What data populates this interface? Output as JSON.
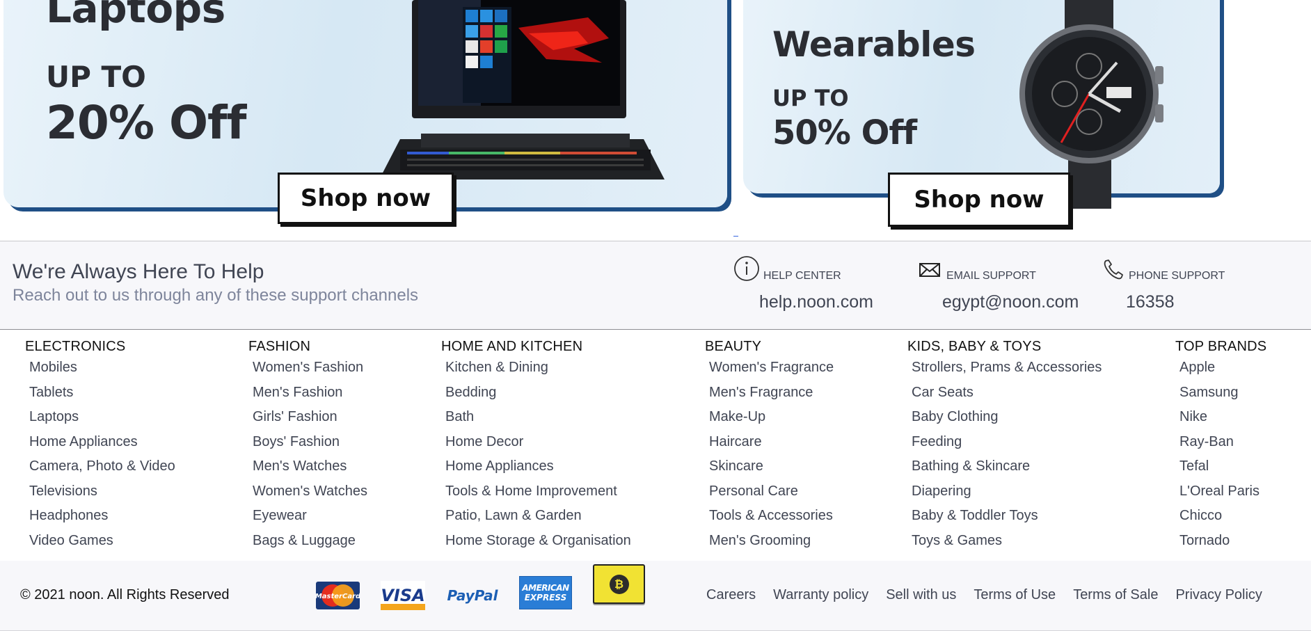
{
  "banners": {
    "laptops": {
      "headline": "Laptops",
      "upto": "UP TO",
      "offer": "20% Off",
      "cta": "Shop now"
    },
    "wearables": {
      "headline": "Wearables",
      "upto": "UP TO",
      "offer": "50% Off",
      "cta": "Shop now"
    }
  },
  "help": {
    "title": "We're Always Here To Help",
    "subtitle": "Reach out to us through any of these support channels",
    "channels": [
      {
        "label": "HELP CENTER",
        "value": "help.noon.com",
        "icon": "info-icon"
      },
      {
        "label": "EMAIL SUPPORT",
        "value": "egypt@noon.com",
        "icon": "envelope-icon"
      },
      {
        "label": "PHONE SUPPORT",
        "value": "16358",
        "icon": "phone-icon"
      }
    ]
  },
  "columns": [
    {
      "heading": "ELECTRONICS",
      "items": [
        "Mobiles",
        "Tablets",
        "Laptops",
        "Home Appliances",
        "Camera, Photo & Video",
        "Televisions",
        "Headphones",
        "Video Games"
      ]
    },
    {
      "heading": "FASHION",
      "items": [
        "Women's Fashion",
        "Men's Fashion",
        "Girls' Fashion",
        "Boys' Fashion",
        "Men's Watches",
        "Women's Watches",
        "Eyewear",
        "Bags & Luggage"
      ]
    },
    {
      "heading": "HOME AND KITCHEN",
      "items": [
        "Kitchen & Dining",
        "Bedding",
        "Bath",
        "Home Decor",
        "Home Appliances",
        "Tools & Home Improvement",
        "Patio, Lawn & Garden",
        "Home Storage & Organisation"
      ]
    },
    {
      "heading": "BEAUTY",
      "items": [
        "Women's Fragrance",
        "Men's Fragrance",
        "Make-Up",
        "Haircare",
        "Skincare",
        "Personal Care",
        "Tools & Accessories",
        "Men's Grooming"
      ]
    },
    {
      "heading": "KIDS, BABY & TOYS",
      "items": [
        "Strollers, Prams & Accessories",
        "Car Seats",
        "Baby Clothing",
        "Feeding",
        "Bathing & Skincare",
        "Diapering",
        "Baby & Toddler Toys",
        "Toys & Games"
      ]
    },
    {
      "heading": "TOP BRANDS",
      "items": [
        "Apple",
        "Samsung",
        "Nike",
        "Ray-Ban",
        "Tefal",
        "L'Oreal Paris",
        "Chicco",
        "Tornado"
      ]
    }
  ],
  "footer": {
    "copyright": "© 2021 noon. All Rights Reserved",
    "payments": {
      "mastercard": "MasterCard",
      "visa": "VISA",
      "paypal": "PayPal",
      "amex_line1": "AMERICAN",
      "amex_line2": "EXPRESS",
      "bitcoin": "₿"
    },
    "links": [
      "Careers",
      "Warranty policy",
      "Sell with us",
      "Terms of Use",
      "Terms of Sale",
      "Privacy Policy"
    ]
  }
}
